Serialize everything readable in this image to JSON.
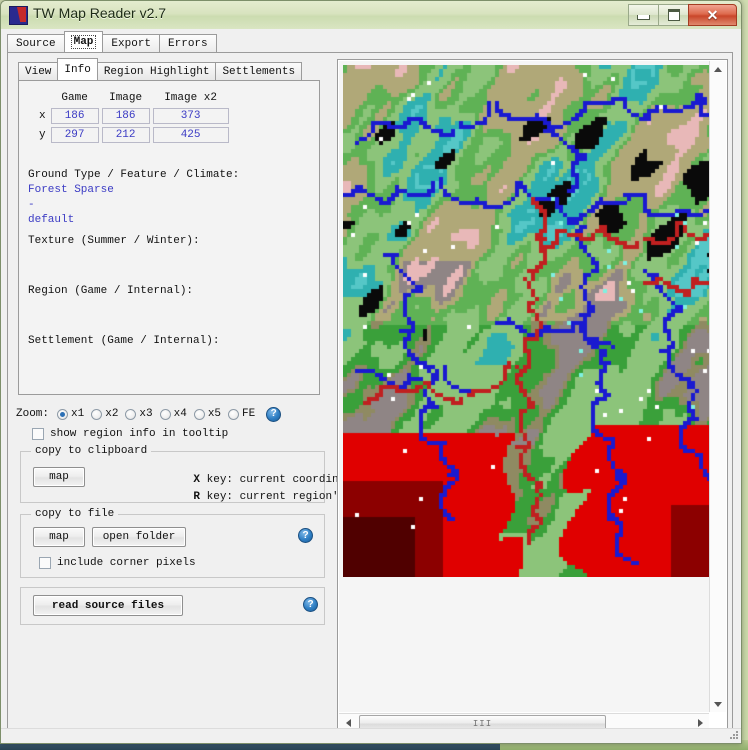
{
  "window": {
    "title": "TW Map Reader v2.7",
    "icon": "app-icon",
    "minimize_label": "",
    "maximize_label": "",
    "close_label": "✕"
  },
  "outer_tabs": [
    {
      "label": "Source",
      "selected": false
    },
    {
      "label": "Map",
      "selected": true
    },
    {
      "label": "Export",
      "selected": false
    },
    {
      "label": "Errors",
      "selected": false
    }
  ],
  "inner_tabs": [
    {
      "label": "View",
      "selected": false
    },
    {
      "label": "Info",
      "selected": true
    },
    {
      "label": "Region Highlight",
      "selected": false
    },
    {
      "label": "Settlements",
      "selected": false
    }
  ],
  "info": {
    "columns": [
      "Game",
      "Image",
      "Image x2"
    ],
    "rows": [
      {
        "axis": "x",
        "game": "186",
        "image": "186",
        "image_x2": "373"
      },
      {
        "axis": "y",
        "game": "297",
        "image": "212",
        "image_x2": "425"
      }
    ],
    "ground_label": "Ground Type / Feature / Climate:",
    "ground_type": "Forest Sparse",
    "feature": "-",
    "climate": "default",
    "texture_label": "Texture (Summer / Winter):",
    "texture_value": "",
    "region_label": "Region (Game / Internal):",
    "region_value": "",
    "settlement_label": "Settlement (Game / Internal):",
    "settlement_value": ""
  },
  "zoom": {
    "label": "Zoom:",
    "options": [
      {
        "label": "x1",
        "selected": true
      },
      {
        "label": "x2",
        "selected": false
      },
      {
        "label": "x3",
        "selected": false
      },
      {
        "label": "x4",
        "selected": false
      },
      {
        "label": "x5",
        "selected": false
      },
      {
        "label": "FE",
        "selected": false
      }
    ],
    "help": "?"
  },
  "tooltip_option": {
    "label": "show region info in tooltip",
    "checked": false
  },
  "clipboard_group": {
    "title": "copy to clipboard",
    "map_button": "map",
    "lines": [
      {
        "key": "X",
        "text": " key: current coordinates"
      },
      {
        "key": "R",
        "text": " key: current region's names"
      }
    ]
  },
  "file_group": {
    "title": "copy to file",
    "map_button": "map",
    "open_folder_button": "open folder",
    "help": "?",
    "corner_option": {
      "label": "include corner pixels",
      "checked": false
    }
  },
  "read_group": {
    "button": "read source files",
    "help": "?"
  },
  "map_viewer": {
    "name": "map-image",
    "vscroll_up": "▲",
    "vscroll_down": "▼",
    "hscroll_left": "◀",
    "hscroll_right": "▶",
    "thumb_grip": "III"
  },
  "colors": {
    "accent_blue": "#3b3bc4",
    "help_blue": "#2f7fc4",
    "window_chrome": "#d8e3bf",
    "close_red": "#c9462a",
    "desktop": "#cfdcb0"
  }
}
